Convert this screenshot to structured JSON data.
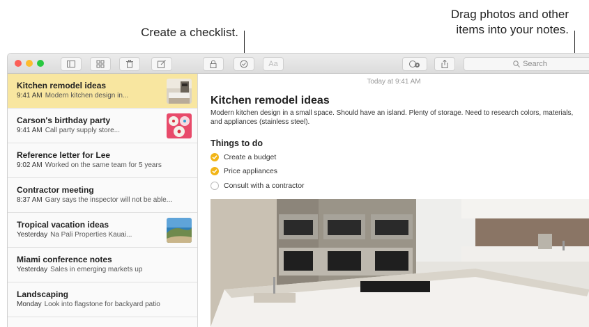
{
  "callouts": {
    "checklist": "Create a checklist.",
    "drag_line1": "Drag photos and other",
    "drag_line2": "items into your notes."
  },
  "toolbar": {
    "buttons": [
      "sidebar-toggle",
      "gallery-view",
      "delete",
      "new-note",
      "lock",
      "checklist",
      "format"
    ],
    "format_label": "Aa",
    "search_placeholder": "Search"
  },
  "colors": {
    "selected": "#f8e6a0",
    "check": "#f2b517",
    "close": "#fc5f57",
    "minimize": "#fdbc2e",
    "zoom": "#28c840"
  },
  "notes": [
    {
      "title": "Kitchen remodel ideas",
      "time": "9:41 AM",
      "preview": "Modern kitchen design in...",
      "selected": true,
      "thumb": "kitchen"
    },
    {
      "title": "Carson's birthday party",
      "time": "9:41 AM",
      "preview": "Call party supply store...",
      "thumb": "cupcakes"
    },
    {
      "title": "Reference letter for Lee",
      "time": "9:02 AM",
      "preview": "Worked on the same team for 5 years"
    },
    {
      "title": "Contractor meeting",
      "time": "8:37 AM",
      "preview": "Gary says the inspector will not be able..."
    },
    {
      "title": "Tropical vacation ideas",
      "time": "Yesterday",
      "preview": "Na Pali Properties Kauai...",
      "thumb": "beach"
    },
    {
      "title": "Miami conference notes",
      "time": "Yesterday",
      "preview": "Sales in emerging markets up"
    },
    {
      "title": "Landscaping",
      "time": "Monday",
      "preview": "Look into flagstone for backyard patio"
    }
  ],
  "editor": {
    "timestamp": "Today at 9:41 AM",
    "title": "Kitchen remodel ideas",
    "body": "Modern kitchen design in a small space. Should have an island. Plenty of storage. Need to research colors, materials, and appliances (stainless steel).",
    "checklist_heading": "Things to do",
    "checklist": [
      {
        "label": "Create a budget",
        "done": true
      },
      {
        "label": "Price appliances",
        "done": true
      },
      {
        "label": "Consult with a contractor",
        "done": false
      }
    ]
  }
}
